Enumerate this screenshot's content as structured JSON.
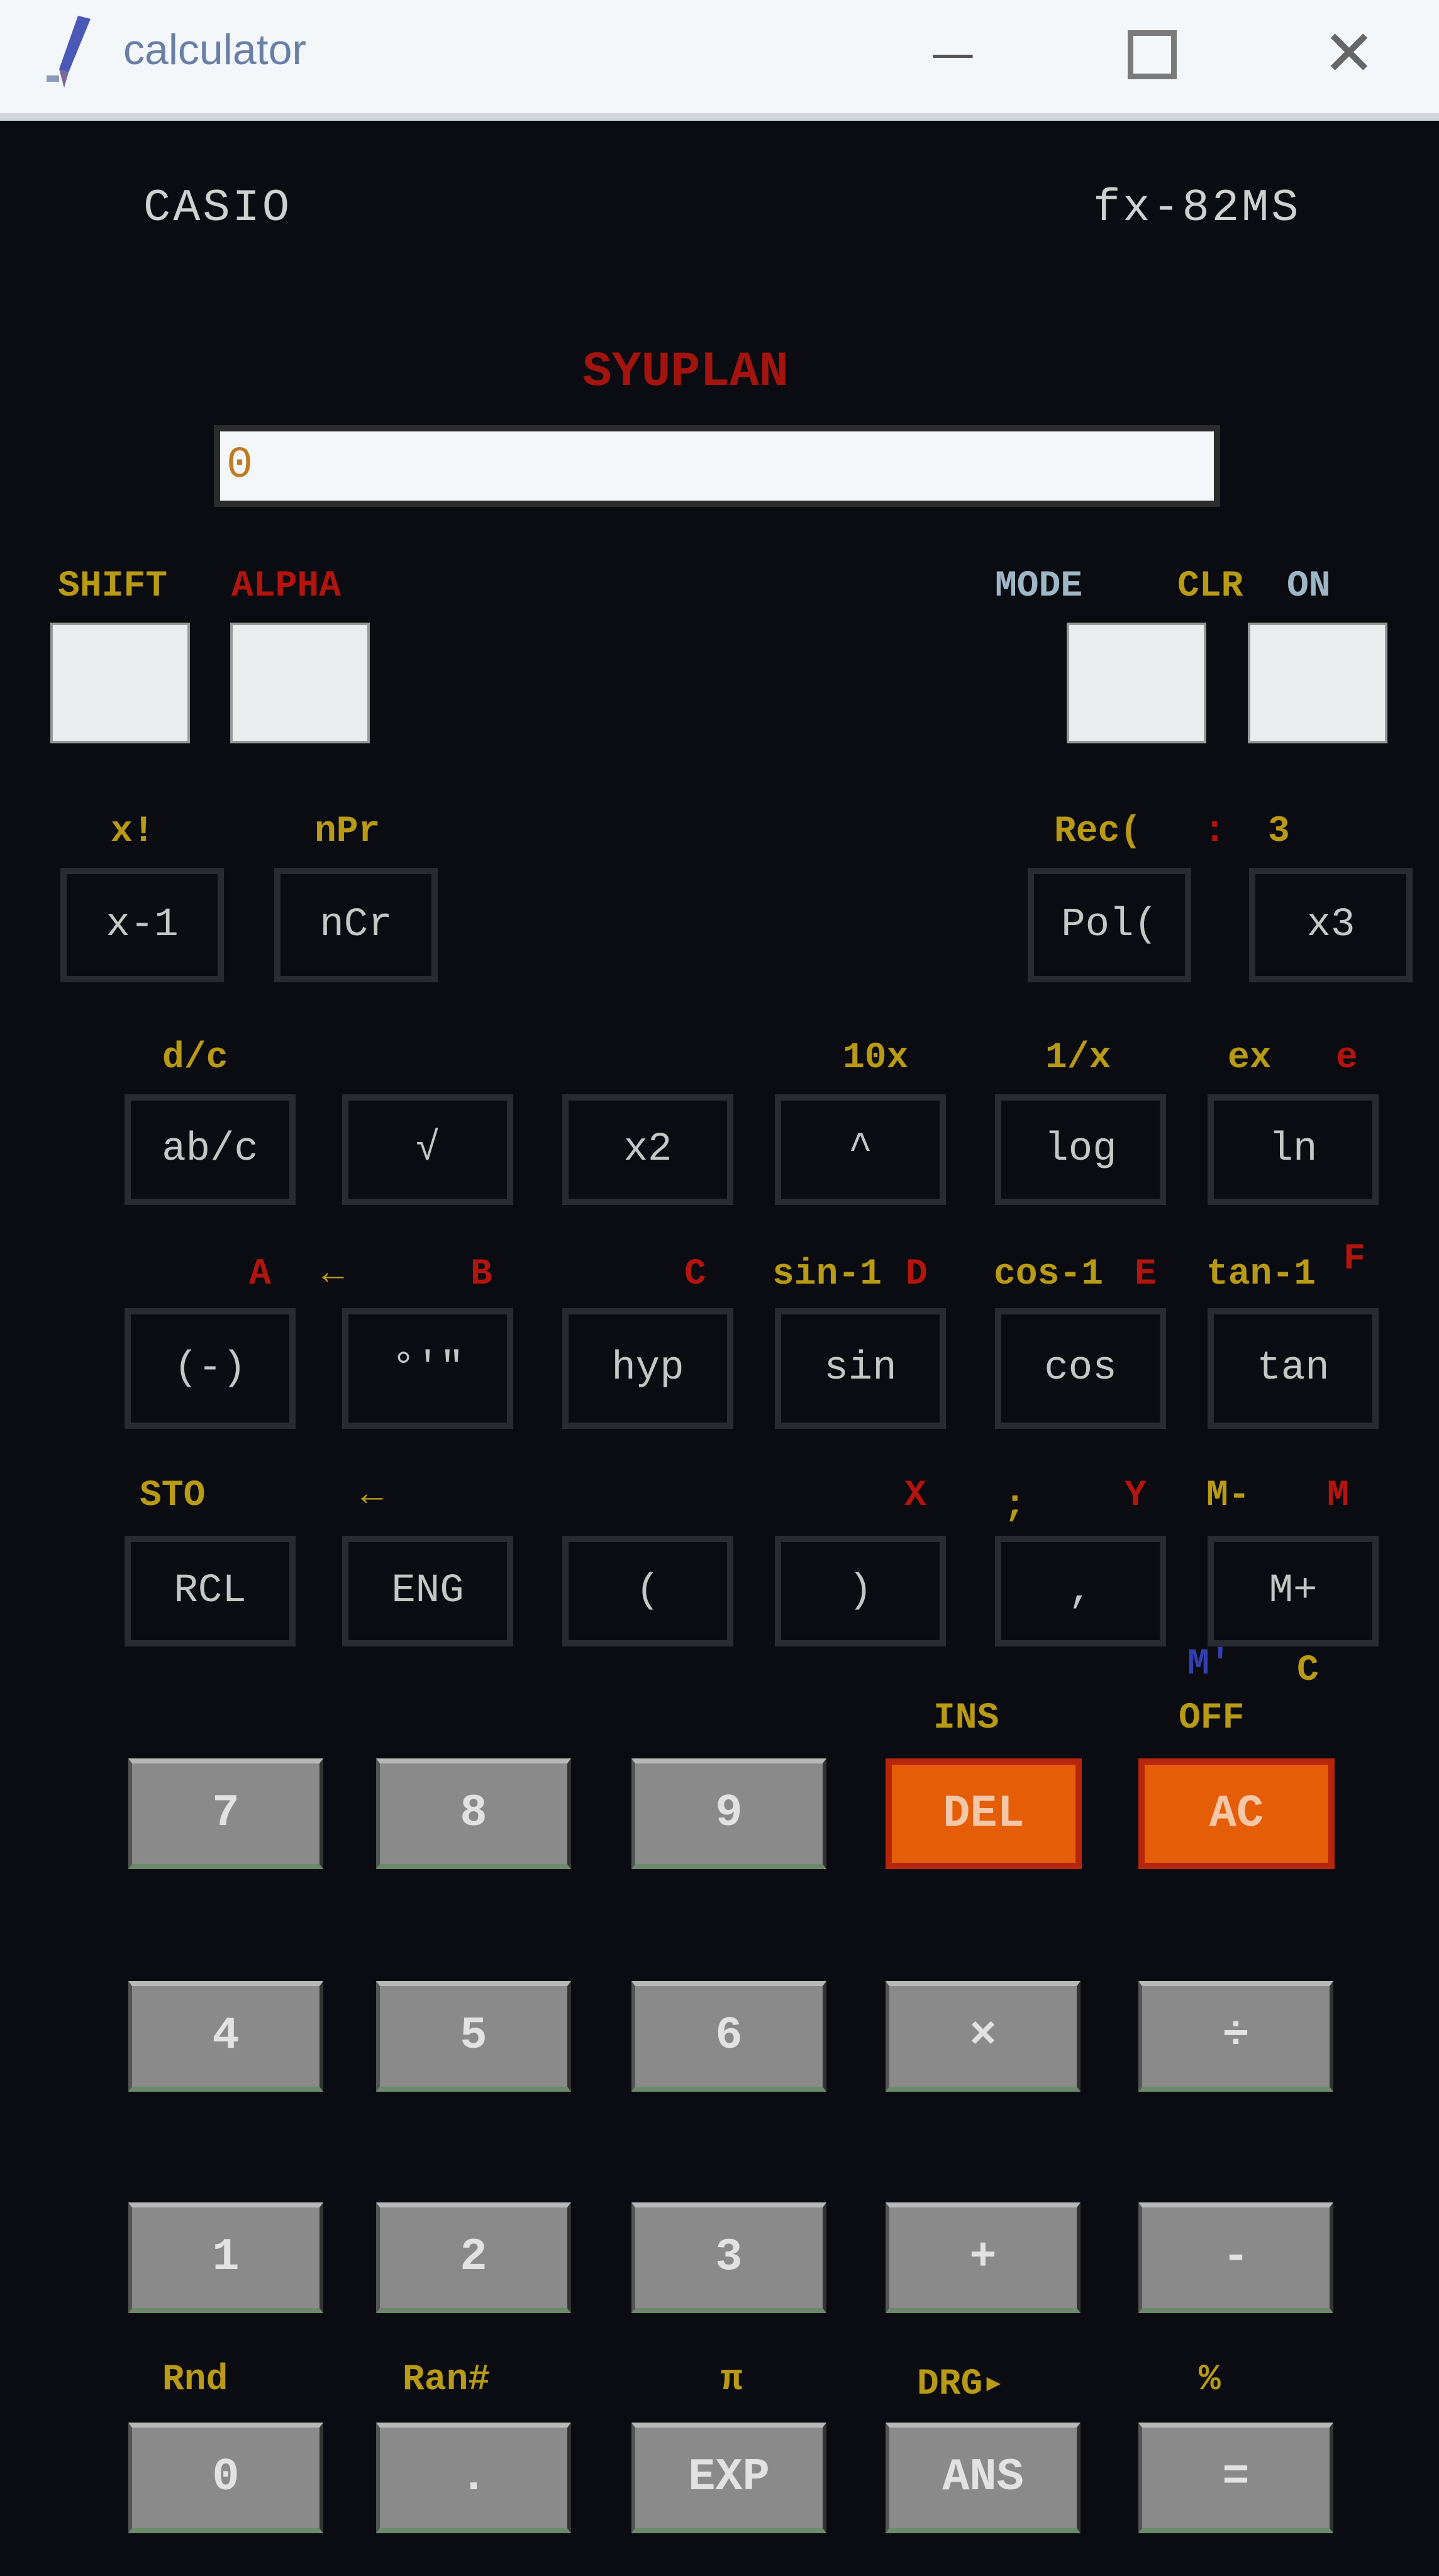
{
  "window": {
    "title": "calculator",
    "min_label": "—",
    "close_label": "✕"
  },
  "brand": {
    "left": "CASIO",
    "right": "fx-82MS"
  },
  "display": {
    "label": "SYUPLAN",
    "value": "0"
  },
  "top_labels": {
    "shift": "SHIFT",
    "alpha": "ALPHA",
    "mode": "MODE",
    "clr": "CLR",
    "on": "ON"
  },
  "row1": {
    "labels": [
      "x!",
      "nPr",
      "Rec(",
      ":",
      "3"
    ],
    "keys": [
      "x-1",
      "nCr",
      "Pol(",
      "x3"
    ]
  },
  "row2": {
    "labels": [
      "d/c",
      "10x",
      "1/x",
      "ex",
      "e"
    ],
    "keys": [
      "ab/c",
      "√",
      "x2",
      "^",
      "log",
      "ln"
    ]
  },
  "row3": {
    "labels": [
      "A",
      "←",
      "B",
      "C",
      "sin-1",
      "D",
      "cos-1",
      "E",
      "tan-1",
      "F"
    ],
    "keys": [
      "(-)",
      "°'\"",
      "hyp",
      "sin",
      "cos",
      "tan"
    ]
  },
  "row4": {
    "labels": [
      "STO",
      "←",
      "X",
      ";",
      "Y",
      "M-",
      "M"
    ],
    "keys": [
      "RCL",
      "ENG",
      "(",
      ")",
      ",",
      "M+"
    ],
    "extra_labels": [
      "M'",
      "C"
    ]
  },
  "row5": {
    "labels": [
      "INS",
      "OFF"
    ],
    "keys": [
      "7",
      "8",
      "9",
      "DEL",
      "AC"
    ]
  },
  "row6": {
    "keys": [
      "4",
      "5",
      "6",
      "×",
      "÷"
    ]
  },
  "row7": {
    "keys": [
      "1",
      "2",
      "3",
      "+",
      "-"
    ]
  },
  "row8": {
    "labels": [
      "Rnd",
      "Ran#",
      "π",
      "DRG▸",
      "%"
    ],
    "keys": [
      "0",
      ".",
      "EXP",
      "ANS",
      "="
    ]
  },
  "colors": {
    "background": "#0b0c12",
    "orange_key": "#e65d07",
    "display_label": "#a4140e",
    "shift_label": "#b89a15"
  }
}
